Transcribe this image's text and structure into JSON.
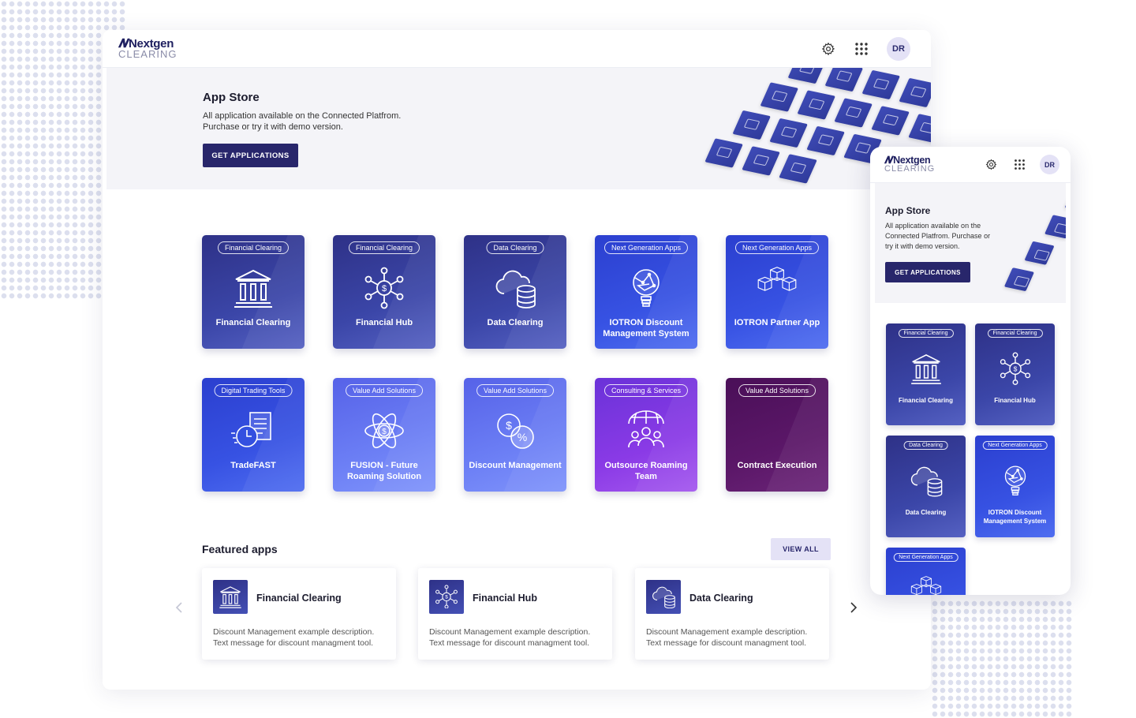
{
  "app": {
    "brand_top": "Nextgen",
    "brand_bottom": "CLEARING",
    "avatar": "DR"
  },
  "hero": {
    "title": "App Store",
    "desc_line1": "All application available on the Connected Platfrom.",
    "desc_line2": "Purchase or try it with demo version.",
    "button": "GET APPLICATIONS"
  },
  "tiles": [
    {
      "tag": "Financial Clearing",
      "name": "Financial Clearing",
      "icon": "bank-icon",
      "style": "navy"
    },
    {
      "tag": "Financial Clearing",
      "name": "Financial Hub",
      "icon": "hub-icon",
      "style": "navy"
    },
    {
      "tag": "Data Clearing",
      "name": "Data Clearing",
      "icon": "cloud-database-icon",
      "style": "navy"
    },
    {
      "tag": "Next Generation Apps",
      "name": "IOTRON Discount Management System",
      "icon": "globe-bulb-icon",
      "style": "blue"
    },
    {
      "tag": "Next Generation Apps",
      "name": "IOTRON Partner App",
      "icon": "cubes-icon",
      "style": "blue"
    },
    {
      "tag": "Digital Trading Tools",
      "name": "TradeFAST",
      "icon": "document-clock-icon",
      "style": "blue"
    },
    {
      "tag": "Value Add Solutions",
      "name": "FUSION - Future Roaming Solution",
      "icon": "atom-dollar-icon",
      "style": "violet"
    },
    {
      "tag": "Value Add Solutions",
      "name": "Discount Management",
      "icon": "dollar-percent-icon",
      "style": "violet"
    },
    {
      "tag": "Consulting & Services",
      "name": "Outsource Roaming Team",
      "icon": "team-globe-icon",
      "style": "purple"
    },
    {
      "tag": "Value Add Solutions",
      "name": "Contract Execution",
      "icon": "",
      "style": "plum"
    }
  ],
  "featured": {
    "title": "Featured apps",
    "view_all": "VIEW ALL",
    "cards": [
      {
        "title": "Financial Clearing",
        "desc_line1": "Discount Management example description.",
        "desc_line2": "Text message for discount managment tool.",
        "icon": "bank-icon"
      },
      {
        "title": "Financial Hub",
        "desc_line1": "Discount Management example description.",
        "desc_line2": "Text message for discount managment tool.",
        "icon": "hub-icon"
      },
      {
        "title": "Data Clearing",
        "desc_line1": "Discount Management example description.",
        "desc_line2": "Text message for discount managment tool.",
        "icon": "cloud-database-icon"
      }
    ]
  },
  "mobile": {
    "hero_title": "App Store",
    "hero_desc_line1": "All application available on the",
    "hero_desc_line2": "Connected Platfrom. Purchase or",
    "hero_desc_line3": "try it with demo version.",
    "button": "GET APPLICATIONS",
    "tiles": [
      {
        "tag": "Financial Clearing",
        "name": "Financial Clearing"
      },
      {
        "tag": "Financial Clearing",
        "name": "Financial Hub"
      },
      {
        "tag": "Data Clearing",
        "name": "Data Clearing"
      },
      {
        "tag": "Next Generation Apps",
        "name": "IOTRON Discount Management System"
      },
      {
        "tag": "Next Generation Apps",
        "name": ""
      }
    ]
  },
  "colors": {
    "primary": "#28266b",
    "navy": "#2e3187",
    "blue": "#3350e0",
    "violet": "#6378f2",
    "purple": "#8a3ae6",
    "plum": "#5b1768"
  }
}
